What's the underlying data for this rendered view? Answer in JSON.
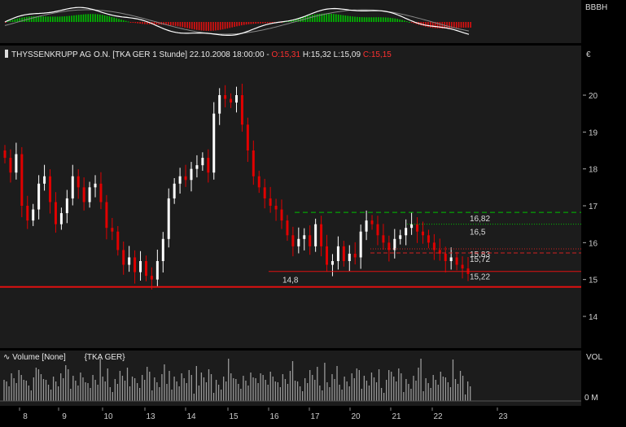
{
  "header": {
    "name": "THYSSENKRUPP AG O.N.",
    "symbol_info": "[TKA GER  1 Stunde]",
    "datetime": "22.10.2008 18:00:00",
    "sep": "-",
    "open": "O:15,31",
    "high": "H:15,32",
    "low": "L:15,09",
    "close": "C:15,15"
  },
  "indicator_panel": {
    "label": "BBBH"
  },
  "price_axis": {
    "unit": "€",
    "ticks": [
      "20",
      "19",
      "18",
      "17",
      "16",
      "15",
      "14"
    ]
  },
  "volume_panel": {
    "title": "Volume [None]",
    "symbol": "{TKA GER}",
    "axis_label": "VOL",
    "axis_tick": "0 M"
  },
  "time_axis": {
    "labels": [
      "8",
      "9",
      "10",
      "13",
      "14",
      "15",
      "16",
      "17",
      "20",
      "21",
      "22",
      "23"
    ]
  },
  "lines": {
    "green_dashed": "16,82",
    "green_dotted": "16,5",
    "red_dotted": "15,83",
    "red_dashed": "15,72",
    "red_solid_short": "15,22",
    "red_support": "14,8"
  },
  "colors": {
    "up": "#ffffff",
    "down": "#e00000",
    "green": "#00c000",
    "bg": "#000000",
    "panel": "#1c1c1c",
    "red": "#e01010"
  },
  "chart_data": {
    "type": "candlestick",
    "title": "THYSSENKRUPP AG O.N. [TKA GER 1 Stunde]",
    "ylabel": "€",
    "ylim": [
      13.3,
      21.2
    ],
    "x_days": [
      "8",
      "9",
      "10",
      "13",
      "14",
      "15",
      "16",
      "17",
      "20",
      "21",
      "22",
      "23"
    ],
    "close_series": [
      18.3,
      17.9,
      18.4,
      17.0,
      16.6,
      16.9,
      17.6,
      17.8,
      17.1,
      16.5,
      16.8,
      17.2,
      17.8,
      17.5,
      17.1,
      17.5,
      17.6,
      17.1,
      16.4,
      16.3,
      15.8,
      15.4,
      15.6,
      15.2,
      15.5,
      15.1,
      15.0,
      15.5,
      16.1,
      17.2,
      17.6,
      17.8,
      17.7,
      18.0,
      18.1,
      18.3,
      17.9,
      19.5,
      20.0,
      19.9,
      19.8,
      20.0,
      19.2,
      18.5,
      17.8,
      17.5,
      17.2,
      17.0,
      16.9,
      16.6,
      16.2,
      15.9,
      16.1,
      16.2,
      15.9,
      16.5,
      15.9,
      15.4,
      15.5,
      15.9,
      15.5,
      15.7,
      15.6,
      16.3,
      16.6,
      16.5,
      16.2,
      16.0,
      15.8,
      16.1,
      16.2,
      16.4,
      16.5,
      16.3,
      16.2,
      16.0,
      15.8,
      15.7,
      15.5,
      15.6,
      15.4,
      15.3,
      15.15
    ],
    "levels": [
      16.82,
      16.5,
      15.83,
      15.72,
      15.22,
      14.8
    ],
    "volume_axis": "0 M"
  }
}
